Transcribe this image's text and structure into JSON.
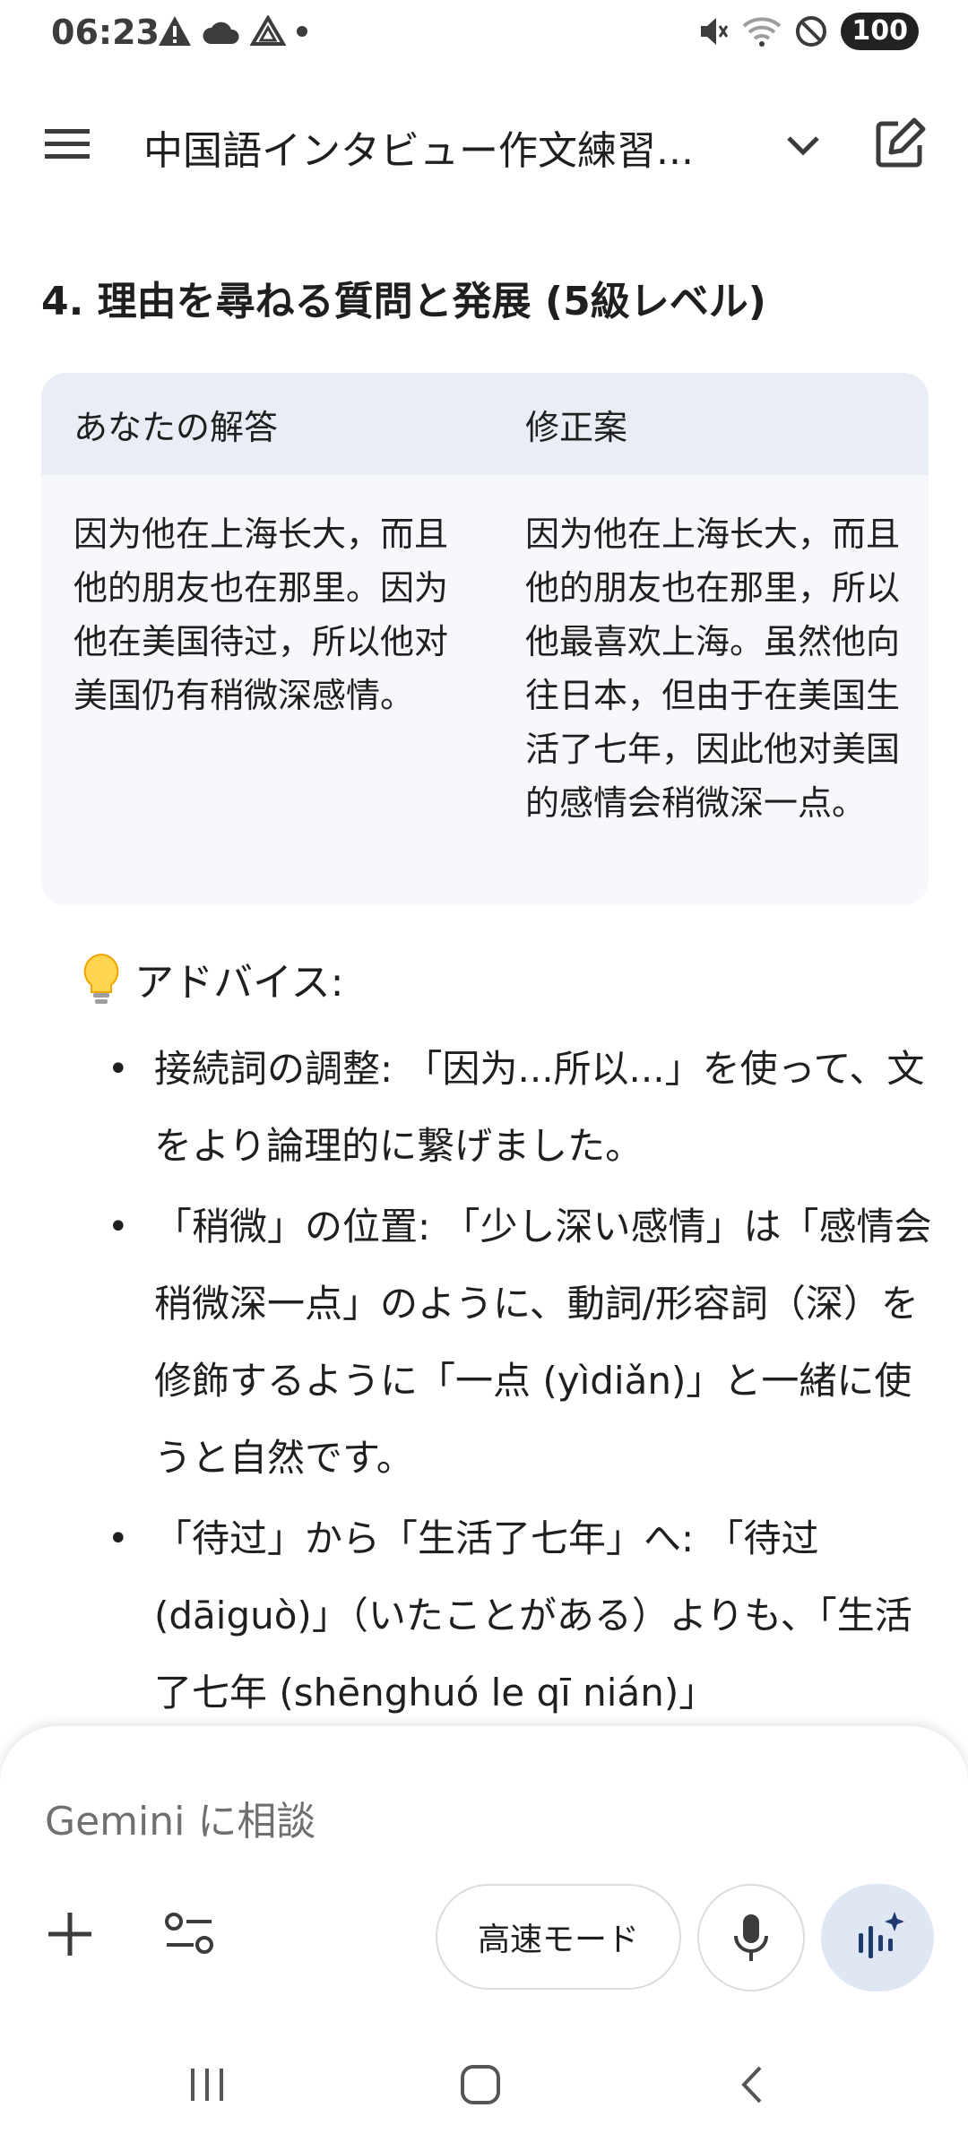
{
  "status_bar": {
    "time": "06:23",
    "battery": "100",
    "left_icons": [
      "warning-icon",
      "cloud-icon",
      "drive-icon",
      "dot-icon"
    ],
    "right_icons": [
      "mute-icon",
      "wifi-icon",
      "blocked-icon"
    ]
  },
  "app_bar": {
    "title": "中国語インタビュー作文練習..."
  },
  "section": {
    "heading": "4. 理由を尋ねる質問と発展 (5級レベル)"
  },
  "table": {
    "headers": [
      "あなたの解答",
      "修正案"
    ],
    "rows": [
      [
        "因为他在上海长大，而且他的朋友也在那里。因为他在美国待过，所以他对美国仍有稍微深感情。",
        "因为他在上海长大，而且他的朋友也在那里，所以他最喜欢上海。虽然他向往日本，但由于在美国生活了七年，因此他对美国的感情会稍微深一点。"
      ]
    ]
  },
  "advice": {
    "label": "アドバイス:",
    "items": [
      "接続詞の調整: 「因为...所以...」を使って、文をより論理的に繋げました。",
      "「稍微」の位置: 「少し深い感情」は「感情会稍微深一点」のように、動詞/形容詞（深）を修飾するように「一点 (yìdiǎn)」と一緒に使うと自然です。",
      "「待过」から「生活了七年」へ: 「待过 (dāiguò)」（いたことがある）よりも、「生活了七年 (shēnghuó le qī nián)」"
    ]
  },
  "input": {
    "placeholder": "Gemini に相談",
    "mode_label": "高速モード"
  },
  "colors": {
    "table_header_bg": "#e9eef6",
    "table_body_bg": "#f6f8fc",
    "live_button_bg": "#dfe7f5"
  }
}
